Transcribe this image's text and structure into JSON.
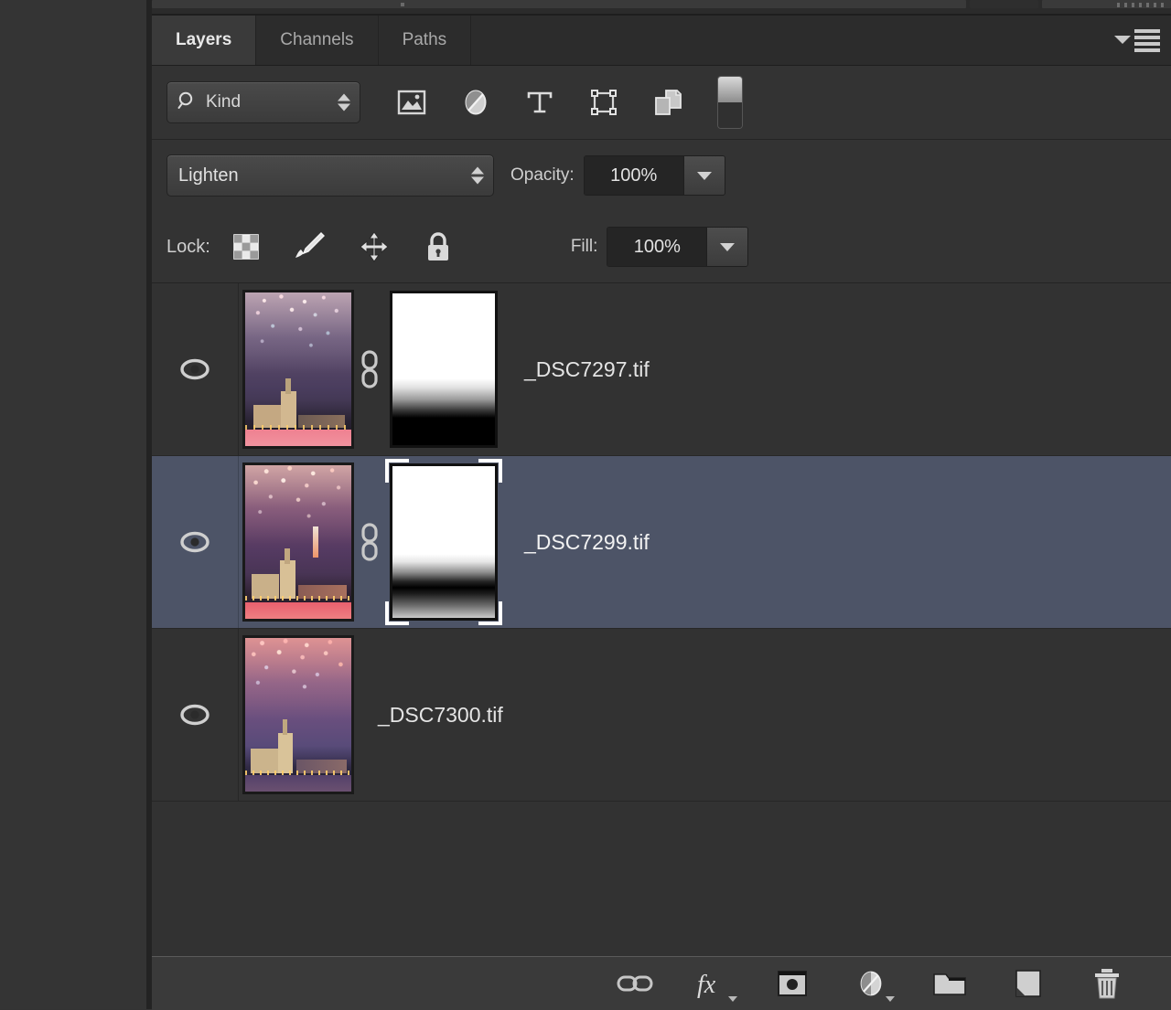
{
  "app": {
    "panel_title": "Layers",
    "theme_bg": "#333333",
    "selection_color": "#4d5467",
    "text_color": "#e4e4e4"
  },
  "tabs": [
    {
      "label": "Layers",
      "active": true
    },
    {
      "label": "Channels",
      "active": false
    },
    {
      "label": "Paths",
      "active": false
    }
  ],
  "panel_menu": {
    "icon": "panel-menu-icon"
  },
  "filter_bar": {
    "kind_label": "Kind",
    "search_icon": "search-icon",
    "stepper_icon": "stepper-arrows-icon",
    "icons": [
      {
        "name": "filter-pixel-layers-icon"
      },
      {
        "name": "filter-adjustment-layers-icon"
      },
      {
        "name": "filter-type-layers-icon"
      },
      {
        "name": "filter-shape-layers-icon"
      },
      {
        "name": "filter-smart-object-layers-icon"
      }
    ],
    "toggle": {
      "name": "filter-enable-toggle",
      "state": "on"
    }
  },
  "blend_row": {
    "blend_mode": "Lighten",
    "opacity_label": "Opacity:",
    "opacity_value": "100%"
  },
  "lock_row": {
    "lock_label": "Lock:",
    "lock_icons": [
      {
        "name": "lock-transparent-pixels-icon"
      },
      {
        "name": "lock-image-pixels-icon"
      },
      {
        "name": "lock-position-icon"
      },
      {
        "name": "lock-all-icon"
      }
    ],
    "fill_label": "Fill:",
    "fill_value": "100%"
  },
  "layers": [
    {
      "name": "_DSC7297.tif",
      "visible": true,
      "selected": false,
      "has_mask": true,
      "mask_selected": false,
      "linked": true,
      "thumb_style": "fireworks-pale-pink"
    },
    {
      "name": "_DSC7299.tif",
      "visible": true,
      "selected": true,
      "has_mask": true,
      "mask_selected": true,
      "linked": true,
      "thumb_style": "fireworks-warm-orange"
    },
    {
      "name": "_DSC7300.tif",
      "visible": true,
      "selected": false,
      "has_mask": false,
      "mask_selected": false,
      "linked": false,
      "thumb_style": "fireworks-red-purple"
    }
  ],
  "bottom_toolbar": [
    {
      "name": "link-layers-button"
    },
    {
      "name": "add-layer-style-button",
      "has_caret": true
    },
    {
      "name": "add-layer-mask-button"
    },
    {
      "name": "new-adjustment-layer-button",
      "has_caret": true
    },
    {
      "name": "new-group-button"
    },
    {
      "name": "new-layer-button"
    },
    {
      "name": "delete-layer-button"
    }
  ]
}
